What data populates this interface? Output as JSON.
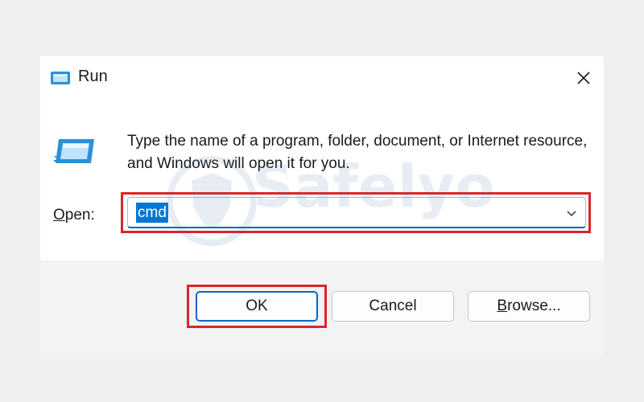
{
  "window": {
    "title": "Run",
    "title_icon": "run-app-icon",
    "close_icon": "close-icon"
  },
  "content": {
    "description": "Type the name of a program, folder, document, or Internet resource, and Windows will open it for you.",
    "open_label_access_key": "O",
    "open_label_rest": "pen:",
    "open_value": "cmd",
    "dropdown_icon": "chevron-down-icon"
  },
  "buttons": {
    "ok_label": "OK",
    "cancel_label": "Cancel",
    "browse_access_key": "B",
    "browse_rest": "rowse..."
  },
  "watermark": {
    "text": "Safelyo"
  },
  "colors": {
    "highlight": "#d9252b",
    "accent": "#0078d4"
  }
}
